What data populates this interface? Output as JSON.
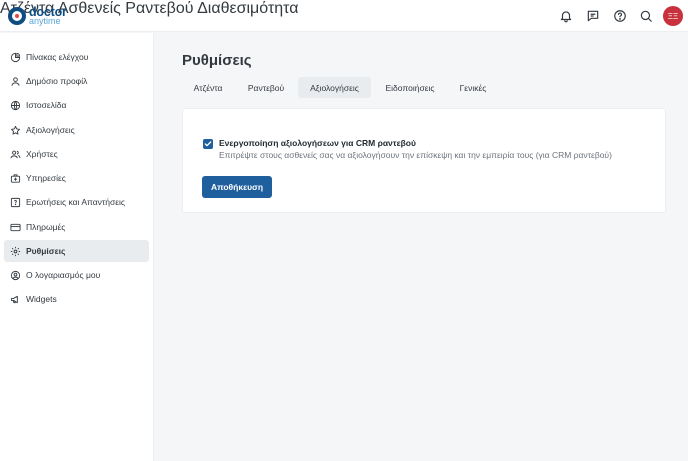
{
  "brand": {
    "line1": "doctor",
    "line2": "anytime"
  },
  "header": {
    "nav": [
      "Ατζέντα",
      "Ασθενείς",
      "Ραντεβού",
      "Διαθεσιμότητα"
    ],
    "avatar_initials": "ΞΞ",
    "icons": [
      "bell-icon",
      "chat-icon",
      "help-icon",
      "search-icon"
    ]
  },
  "sidebar": {
    "items": [
      {
        "label": "Πίνακας ελέγχου",
        "icon": "dashboard-icon"
      },
      {
        "label": "Δημόσιο προφίλ",
        "icon": "user-icon"
      },
      {
        "label": "Ιστοσελίδα",
        "icon": "globe-icon"
      },
      {
        "label": "Αξιολογήσεις",
        "icon": "star-icon"
      },
      {
        "label": "Χρήστες",
        "icon": "users-icon"
      },
      {
        "label": "Υπηρεσίες",
        "icon": "medical-bag-icon"
      },
      {
        "label": "Ερωτήσεις και Απαντήσεις",
        "icon": "qa-icon"
      },
      {
        "label": "Πληρωμές",
        "icon": "card-icon"
      },
      {
        "label": "Ρυθμίσεις",
        "icon": "gear-icon",
        "active": true
      },
      {
        "label": "Ο λογαριασμός μου",
        "icon": "account-icon"
      },
      {
        "label": "Widgets",
        "icon": "megaphone-icon"
      }
    ]
  },
  "main": {
    "title": "Ρυθμίσεις",
    "tabs": [
      {
        "label": "Ατζέντα"
      },
      {
        "label": "Ραντεβού"
      },
      {
        "label": "Αξιολογήσεις",
        "active": true
      },
      {
        "label": "Ειδοποιήσεις"
      },
      {
        "label": "Γενικές"
      }
    ],
    "setting": {
      "checked": true,
      "label": "Ενεργοποίηση αξιολογήσεων για CRM ραντεβού",
      "help": "Επιτρέψτε στους ασθενείς σας να αξιολογήσουν την επίσκεψη και την εμπειρία τους (για CRM ραντεβού)"
    },
    "save_label": "Αποθήκευση"
  },
  "colors": {
    "primary": "#1f5f9e",
    "brand": "#0f4c81",
    "avatar": "#c8323c",
    "active_bg": "#e9ecef"
  }
}
